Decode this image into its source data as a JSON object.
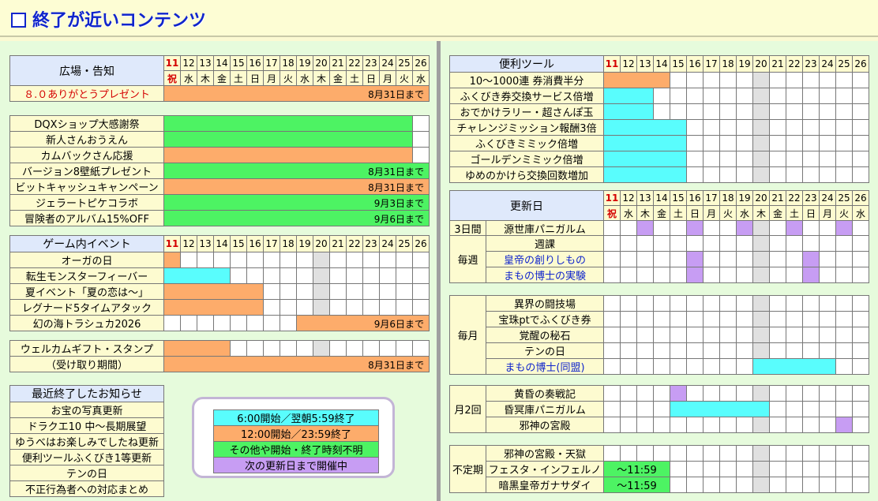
{
  "title": "終了が近いコンテンツ",
  "colors": {
    "green": "#4df363",
    "orange": "#fdac6b",
    "cyan": "#59fdfd",
    "purple": "#c79df3",
    "gray": "#e0e0e0",
    "weekend_red": "#d40000",
    "title_blue": "#1025cc"
  },
  "days": [
    "11",
    "12",
    "13",
    "14",
    "15",
    "16",
    "17",
    "18",
    "19",
    "20",
    "21",
    "22",
    "23",
    "24",
    "25",
    "26"
  ],
  "weekdays": [
    "祝",
    "水",
    "木",
    "金",
    "土",
    "日",
    "月",
    "火",
    "水",
    "木",
    "金",
    "土",
    "日",
    "月",
    "火",
    "水"
  ],
  "notice": {
    "header": "広場・告知",
    "rows": [
      {
        "label": "８.０ありがとうプレゼント",
        "label_color": "#d40000",
        "note": "8月31日まで",
        "color": "orange"
      }
    ]
  },
  "campaigns": [
    {
      "label": "DQXショップ大感謝祭",
      "color": "green",
      "note": ""
    },
    {
      "label": "新人さんおうえん",
      "color": "green",
      "note": ""
    },
    {
      "label": "カムバックさん応援",
      "color": "orange",
      "note": ""
    },
    {
      "label": "バージョン8壁紙プレゼント",
      "color": "green",
      "note": "8月31日まで"
    },
    {
      "label": "ビットキャッシュキャンペーン",
      "color": "orange",
      "note": "8月31日まで"
    },
    {
      "label": "ジェラートピケコラボ",
      "color": "green",
      "note": "9月3日まで"
    },
    {
      "label": "冒険者のアルバム15%OFF",
      "color": "green",
      "note": "9月6日まで"
    }
  ],
  "events": {
    "header": "ゲーム内イベント",
    "rows": [
      {
        "label": "オーガの日",
        "note": ""
      },
      {
        "label": "転生モンスターフィーバー",
        "note": ""
      },
      {
        "label": "夏イベント「夏の恋は～」",
        "note": ""
      },
      {
        "label": "レグナード5タイムアタック",
        "note": ""
      },
      {
        "label": "幻の海トラシュカ2026",
        "note": "9月6日まで"
      }
    ]
  },
  "welcome": {
    "rows": [
      {
        "label": "ウェルカムギフト・スタンプ",
        "note": ""
      },
      {
        "label": "（受け取り期間）",
        "note": "8月31日まで"
      }
    ]
  },
  "recent": {
    "header": "最近終了したお知らせ",
    "items": [
      "お宝の写真更新",
      "ドラクエ10 中～長期展望",
      "ゆうべはお楽しみでしたね更新",
      "便利ツールふくびき1等更新",
      "テンの日",
      "不正行為者への対応まとめ"
    ]
  },
  "legend": [
    {
      "text": "6:00開始／翌朝5:59終了",
      "color": "cyan"
    },
    {
      "text": "12:00開始／23:59終了",
      "color": "orange"
    },
    {
      "text": "その他や開始・終了時刻不明",
      "color": "green"
    },
    {
      "text": "次の更新日まで開催中",
      "color": "purple"
    }
  ],
  "tools": {
    "header": "便利ツール",
    "rows": [
      {
        "label": "10～1000連 券消費半分"
      },
      {
        "label": "ふくびき券交換サービス倍増"
      },
      {
        "label": "おでかけラリー・超さんぽ玉"
      },
      {
        "label": "チャレンジミッション報酬3倍"
      },
      {
        "label": "ふくびきミミック倍増"
      },
      {
        "label": "ゴールデンミミック倍増"
      },
      {
        "label": "ゆめのかけら交換回数増加"
      }
    ]
  },
  "updates": {
    "header": "更新日",
    "groups": [
      {
        "category": "3日間",
        "rows": [
          {
            "label": "源世庫パニガルム",
            "label_color": "#000"
          }
        ]
      },
      {
        "category": "毎週",
        "rows": [
          {
            "label": "週課",
            "label_color": "#000"
          },
          {
            "label": "皇帝の創りしもの",
            "label_color": "#1025cc"
          },
          {
            "label": "まもの博士の実験",
            "label_color": "#1025cc"
          }
        ]
      },
      {
        "category": "毎月",
        "rows": [
          {
            "label": "異界の闘技場",
            "label_color": "#000"
          },
          {
            "label": "宝珠ptでふくびき券",
            "label_color": "#000"
          },
          {
            "label": "覚醒の秘石",
            "label_color": "#000"
          },
          {
            "label": "テンの日",
            "label_color": "#000"
          },
          {
            "label": "まもの博士(同盟)",
            "label_color": "#1025cc"
          }
        ]
      },
      {
        "category": "月2回",
        "rows": [
          {
            "label": "黄昏の奏戦記",
            "label_color": "#000"
          },
          {
            "label": "昏冥庫パニガルム",
            "label_color": "#000"
          },
          {
            "label": "邪神の宮殿",
            "label_color": "#000"
          }
        ]
      },
      {
        "category": "不定期",
        "rows": [
          {
            "label": "邪神の宮殿・天獄",
            "label_color": "#000",
            "time": ""
          },
          {
            "label": "フェスタ・インフェルノ",
            "label_color": "#000",
            "time": "～11:59"
          },
          {
            "label": "暗黒皇帝ガナサダイ",
            "label_color": "#000",
            "time": "～11:59"
          }
        ]
      }
    ]
  }
}
